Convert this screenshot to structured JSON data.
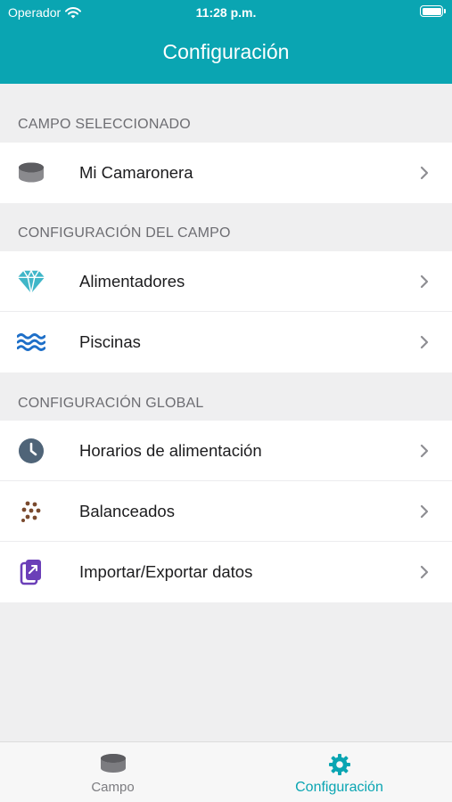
{
  "status_bar": {
    "carrier": "Operador",
    "time": "11:28 p.m."
  },
  "nav": {
    "title": "Configuración"
  },
  "sections": [
    {
      "header": "CAMPO SELECCIONADO",
      "rows": [
        {
          "label": "Mi Camaronera",
          "icon": "database-icon"
        }
      ]
    },
    {
      "header": "CONFIGURACIÓN DEL CAMPO",
      "rows": [
        {
          "label": "Alimentadores",
          "icon": "diamond-icon"
        },
        {
          "label": "Piscinas",
          "icon": "waves-icon"
        }
      ]
    },
    {
      "header": "CONFIGURACIÓN GLOBAL",
      "rows": [
        {
          "label": "Horarios de alimentación",
          "icon": "clock-icon"
        },
        {
          "label": "Balanceados",
          "icon": "pellets-icon"
        },
        {
          "label": "Importar/Exportar datos",
          "icon": "import-export-icon"
        }
      ]
    }
  ],
  "tab_bar": {
    "tabs": [
      {
        "label": "Campo",
        "icon": "database-icon",
        "active": false
      },
      {
        "label": "Configuración",
        "icon": "gear-icon",
        "active": true
      }
    ]
  },
  "colors": {
    "accent": "#0aa5b2",
    "background": "#efeff0",
    "section_header_text": "#6d6d72",
    "inactive_tab": "#7c7c80"
  }
}
